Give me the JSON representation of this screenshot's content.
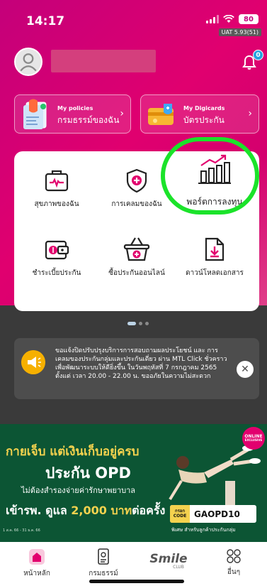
{
  "status_bar": {
    "time": "14:17",
    "battery": "80",
    "build": "UAT 5.93(51)"
  },
  "header": {
    "notification_count": "0"
  },
  "quick_cards": [
    {
      "small": "My policies",
      "big": "กรมธรรม์ของฉัน"
    },
    {
      "small": "My Digicards",
      "big": "บัตรประกัน"
    }
  ],
  "menu_items": [
    {
      "label": "สุขภาพของฉัน",
      "icon": "first-aid-kit-icon"
    },
    {
      "label": "การเคลมของฉัน",
      "icon": "shield-plus-icon"
    },
    {
      "label": "พอร์ตการลงทุน",
      "icon": "investment-chart-icon"
    },
    {
      "label": "ชำระเบี้ยประกัน",
      "icon": "wallet-icon"
    },
    {
      "label": "ซื้อประกันออนไลน์",
      "icon": "basket-icon"
    },
    {
      "label": "ดาวน์โหลดเอกสาร",
      "icon": "download-document-icon"
    }
  ],
  "notice": {
    "text": "ขอแจ้งปิดปรับปรุงบริการการสอบถามผลประโยชน์ และ การเคลมของประกันกลุ่มและประกันเดี่ยว ผ่าน MTL Click ชั่วคราว เพื่อพัฒนาระบบให้ดียิ่งขึ้น ในวันพฤหัสที่ 7 กรกฎาคม 2565 ตั้งแต่ เวลา 20.00 - 22.00 น. ขออภัยในความไม่สะดวก"
  },
  "banner": {
    "line1": "กายเจ็บ แต่เงินเก็บอยู่ครบ",
    "line2": "ประกัน OPD",
    "line3": "ไม่ต้องสำรองจ่ายค่ารักษาพยาบาล",
    "line4_a": "เข้ารพ. ดูแล ",
    "line4_b": "2,000 บาท",
    "line4_c": "ต่อครั้ง",
    "fine_print": "1 ส.ค. 66 - 31 ธ.ค. 66",
    "online_a": "ONLINE",
    "online_b": "EXCLUSIVE",
    "code_label_a": "กรอก",
    "code_label_b": "CODE",
    "code": "GAOPD10",
    "special": "พิเศษ สำหรับลูกค้าประกันกลุ่ม"
  },
  "tabs": [
    {
      "label": "หน้าหลัก"
    },
    {
      "label": "กรมธรรม์"
    },
    {
      "label": "Smile",
      "sub": "CLUB"
    },
    {
      "label": "อื่นๆ"
    }
  ],
  "colors": {
    "brand": "#e2006e",
    "highlight": "#1be32a",
    "banner_bg": "#0c5534",
    "accent_yellow": "#f4d24e"
  }
}
